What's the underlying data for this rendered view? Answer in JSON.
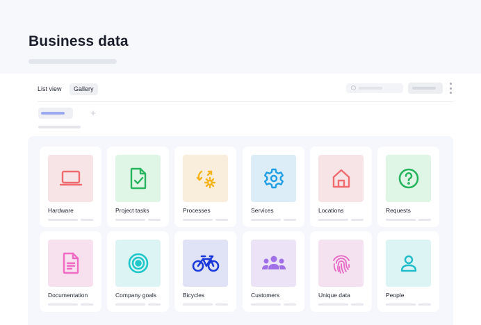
{
  "page": {
    "title": "Business data"
  },
  "toolbar": {
    "tabs": [
      {
        "label": "List view",
        "active": false
      },
      {
        "label": "Gallery",
        "active": true
      }
    ],
    "add_filter_label": "+"
  },
  "colors": {
    "active_filter": "#9eaaf0",
    "header_band": "#f7f8fc",
    "gallery_background": "#f5f7fc"
  },
  "gallery": {
    "cards": [
      {
        "label": "Hardware",
        "icon": "laptop-icon",
        "bg": "#f6e4e6",
        "fg": "#ef6b6f"
      },
      {
        "label": "Project tasks",
        "icon": "checked-document-icon",
        "bg": "#dff5e6",
        "fg": "#27b45e"
      },
      {
        "label": "Processes",
        "icon": "process-cycle-icon",
        "bg": "#f8eedb",
        "fg": "#f6b318"
      },
      {
        "label": "Services",
        "icon": "gear-icon",
        "bg": "#dcedf7",
        "fg": "#1f9ee6"
      },
      {
        "label": "Locations",
        "icon": "home-icon",
        "bg": "#f6e4e6",
        "fg": "#ef6b6f"
      },
      {
        "label": "Requests",
        "icon": "question-icon",
        "bg": "#dff5e6",
        "fg": "#27b45e"
      },
      {
        "label": "Documentation",
        "icon": "document-icon",
        "bg": "#f8e1ee",
        "fg": "#f06bc4"
      },
      {
        "label": "Company goals",
        "icon": "target-icon",
        "bg": "#ddf4f5",
        "fg": "#1fc7c9"
      },
      {
        "label": "Bicycles",
        "icon": "bicycle-icon",
        "bg": "#e0e2f6",
        "fg": "#1b3ad9"
      },
      {
        "label": "Customers",
        "icon": "group-icon",
        "bg": "#ede3f6",
        "fg": "#a070e8"
      },
      {
        "label": "Unique data",
        "icon": "fingerprint-icon",
        "bg": "#f5e2f1",
        "fg": "#e668c4"
      },
      {
        "label": "People",
        "icon": "person-icon",
        "bg": "#ddf4f5",
        "fg": "#20bcc9"
      }
    ]
  }
}
